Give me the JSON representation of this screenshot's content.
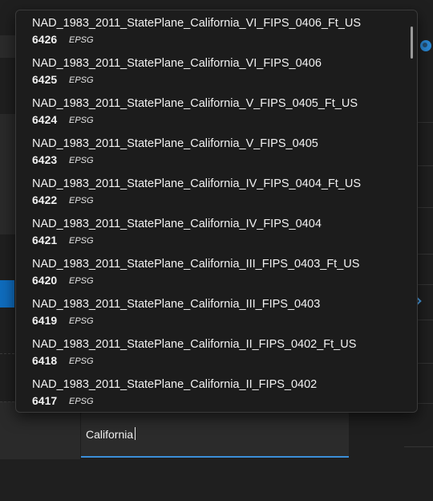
{
  "search": {
    "value": "California"
  },
  "dropdown": {
    "options": [
      {
        "name": "NAD_1983_2011_StatePlane_California_VI_FIPS_0406_Ft_US",
        "code": "6426",
        "authority": "EPSG"
      },
      {
        "name": "NAD_1983_2011_StatePlane_California_VI_FIPS_0406",
        "code": "6425",
        "authority": "EPSG"
      },
      {
        "name": "NAD_1983_2011_StatePlane_California_V_FIPS_0405_Ft_US",
        "code": "6424",
        "authority": "EPSG"
      },
      {
        "name": "NAD_1983_2011_StatePlane_California_V_FIPS_0405",
        "code": "6423",
        "authority": "EPSG"
      },
      {
        "name": "NAD_1983_2011_StatePlane_California_IV_FIPS_0404_Ft_US",
        "code": "6422",
        "authority": "EPSG"
      },
      {
        "name": "NAD_1983_2011_StatePlane_California_IV_FIPS_0404",
        "code": "6421",
        "authority": "EPSG"
      },
      {
        "name": "NAD_1983_2011_StatePlane_California_III_FIPS_0403_Ft_US",
        "code": "6420",
        "authority": "EPSG"
      },
      {
        "name": "NAD_1983_2011_StatePlane_California_III_FIPS_0403",
        "code": "6419",
        "authority": "EPSG"
      },
      {
        "name": "NAD_1983_2011_StatePlane_California_II_FIPS_0402_Ft_US",
        "code": "6418",
        "authority": "EPSG"
      },
      {
        "name": "NAD_1983_2011_StatePlane_California_II_FIPS_0402",
        "code": "6417",
        "authority": "EPSG"
      }
    ]
  },
  "icons": {
    "globe": "globe-icon",
    "chevron": "chevron-right-icon"
  },
  "colors": {
    "accent": "#0f6cbd",
    "background": "#1f1f1f",
    "dropdown": "#1c1c1c"
  }
}
